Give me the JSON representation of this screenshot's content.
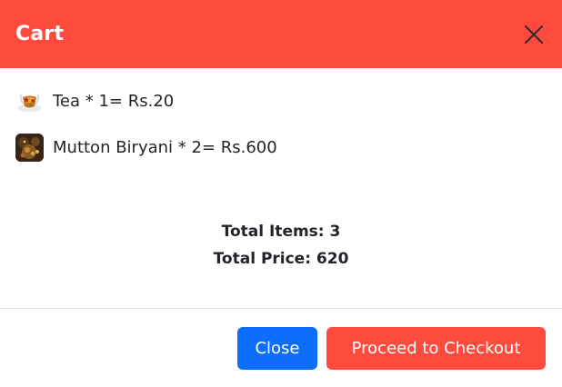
{
  "modal": {
    "title": "Cart"
  },
  "cart": {
    "items": [
      {
        "line": "Tea * 1= Rs.20"
      },
      {
        "line": "Mutton Biryani * 2= Rs.600"
      }
    ]
  },
  "totals": {
    "items_text": "Total Items: 3",
    "price_text": "Total Price: 620"
  },
  "footer": {
    "close_label": "Close",
    "checkout_label": "Proceed to Checkout"
  },
  "colors": {
    "header_bg": "#ff4b3e",
    "primary_button": "#0d6efd",
    "checkout_button": "#ff4b3e"
  },
  "icons": {
    "close": "close-icon"
  }
}
